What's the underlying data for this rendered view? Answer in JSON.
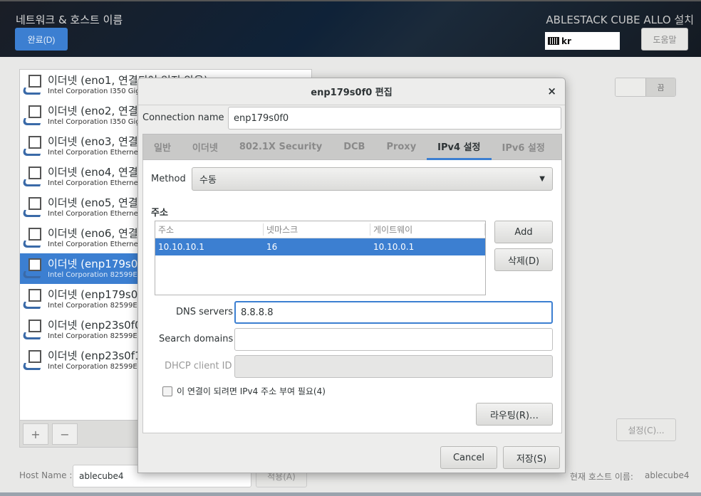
{
  "header": {
    "title": "네트워크 & 호스트 이름",
    "done_label": "완료(D)",
    "installer_title": "ABLESTACK CUBE ALLO 설치",
    "keyboard_layout": "kr",
    "help_label": "도움말"
  },
  "devices": [
    {
      "name": "이더넷 (eno1, 연결되어 있지 않음)",
      "desc": "Intel Corporation I350 Gigabit Network Connection"
    },
    {
      "name": "이더넷 (eno2, 연결되어 있지 않음)",
      "desc": "Intel Corporation I350 Gigabit Network Connection"
    },
    {
      "name": "이더넷 (eno3, 연결되어 있지 않음)",
      "desc": "Intel Corporation Ethernet Controller"
    },
    {
      "name": "이더넷 (eno4, 연결되어 있지 않음)",
      "desc": "Intel Corporation Ethernet Controller"
    },
    {
      "name": "이더넷 (eno5, 연결되어 있지 않음)",
      "desc": "Intel Corporation Ethernet Controller"
    },
    {
      "name": "이더넷 (eno6, 연결되어 있지 않음)",
      "desc": "Intel Corporation Ethernet Controller"
    },
    {
      "name": "이더넷 (enp179s0f0)",
      "desc": "Intel Corporation 82599ES 10-Gigabit",
      "selected": true
    },
    {
      "name": "이더넷 (enp179s0f1)",
      "desc": "Intel Corporation 82599ES 10-Gigabit"
    },
    {
      "name": "이더넷 (enp23s0f0)",
      "desc": "Intel Corporation 82599ES 10-Gigabit"
    },
    {
      "name": "이더넷 (enp23s0f1)",
      "desc": "Intel Corporation 82599ES 10-Gigabit"
    }
  ],
  "list_controls": {
    "add": "+",
    "remove": "−"
  },
  "toggle": {
    "state_label": "끔"
  },
  "configure_label": "설정(C)...",
  "hostname": {
    "label": "Host Name :",
    "value": "ablecube4",
    "apply_label": "적용(A)",
    "current_label": "현재 호스트 이름:",
    "current_value": "ablecube4"
  },
  "dialog": {
    "title": "enp179s0f0 편집",
    "close": "×",
    "connection_name_label": "Connection name",
    "connection_name": "enp179s0f0",
    "tabs": [
      "일반",
      "이더넷",
      "802.1X Security",
      "DCB",
      "Proxy",
      "IPv4 설정",
      "IPv6 설정"
    ],
    "active_tab": "IPv4 설정",
    "method_label": "Method",
    "method_value": "수동",
    "addresses_heading": "주소",
    "columns": [
      "주소",
      "넷마스크",
      "게이트웨이"
    ],
    "rows": [
      [
        "10.10.10.1",
        "16",
        "10.10.0.1"
      ]
    ],
    "add_label": "Add",
    "delete_label": "삭제(D)",
    "dns_label": "DNS servers",
    "dns_value": "8.8.8.8",
    "search_label": "Search domains",
    "search_value": "",
    "dhcp_label": "DHCP client ID",
    "require_ipv4_label": "이 연결이 되려면 IPv4 주소 부여 필요(4)",
    "require_ipv4_checked": false,
    "routes_label": "라우팅(R)…",
    "cancel_label": "Cancel",
    "save_label": "저장(S)"
  },
  "colors": {
    "accent": "#3c7fd1"
  }
}
